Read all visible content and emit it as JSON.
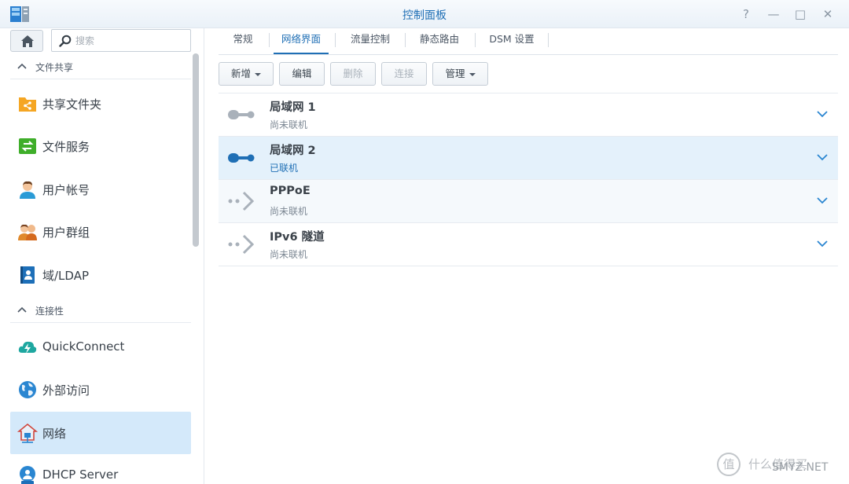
{
  "window": {
    "title": "控制面板",
    "help_glyph": "?",
    "min_glyph": "—",
    "max_glyph": "□",
    "close_glyph": "✕"
  },
  "sidebar": {
    "search_placeholder": "搜索",
    "sections": [
      {
        "label": "文件共享",
        "items": [
          {
            "label": "共享文件夹",
            "icon": "shared-folder-icon"
          },
          {
            "label": "文件服务",
            "icon": "file-services-icon"
          },
          {
            "label": "用户帐号",
            "icon": "user-icon"
          },
          {
            "label": "用户群组",
            "icon": "group-icon"
          },
          {
            "label": "域/LDAP",
            "icon": "domain-ldap-icon"
          }
        ]
      },
      {
        "label": "连接性",
        "items": [
          {
            "label": "QuickConnect",
            "icon": "quickconnect-icon"
          },
          {
            "label": "外部访问",
            "icon": "globe-icon"
          },
          {
            "label": "网络",
            "icon": "network-house-icon",
            "active": true
          },
          {
            "label": "DHCP Server",
            "icon": "dhcp-icon"
          }
        ]
      }
    ]
  },
  "tabs": [
    "常规",
    "网络界面",
    "流量控制",
    "静态路由",
    "DSM 设置"
  ],
  "active_tab": "网络界面",
  "toolbar": {
    "create": "新增",
    "edit": "编辑",
    "delete": "删除",
    "connect": "连接",
    "manage": "管理"
  },
  "interfaces": [
    {
      "name": "局域网 1",
      "status": "尚未联机",
      "icon": "lan-disconnected-icon"
    },
    {
      "name": "局域网 2",
      "status": "已联机",
      "icon": "lan-connected-icon"
    },
    {
      "name": "PPPoE",
      "status": "尚未联机",
      "icon": "pppoe-icon"
    },
    {
      "name": "IPv6 隧道",
      "status": "尚未联机",
      "icon": "ipv6-tunnel-icon"
    }
  ],
  "watermark": {
    "logo_char": "值",
    "text": "什么值得买",
    "site": "SMYZ.NET"
  },
  "colors": {
    "accent": "#1f6fb5",
    "selected_bg": "#d4e9fa",
    "connected": "#1f6fb5",
    "disconnected": "#a9b1ba"
  }
}
